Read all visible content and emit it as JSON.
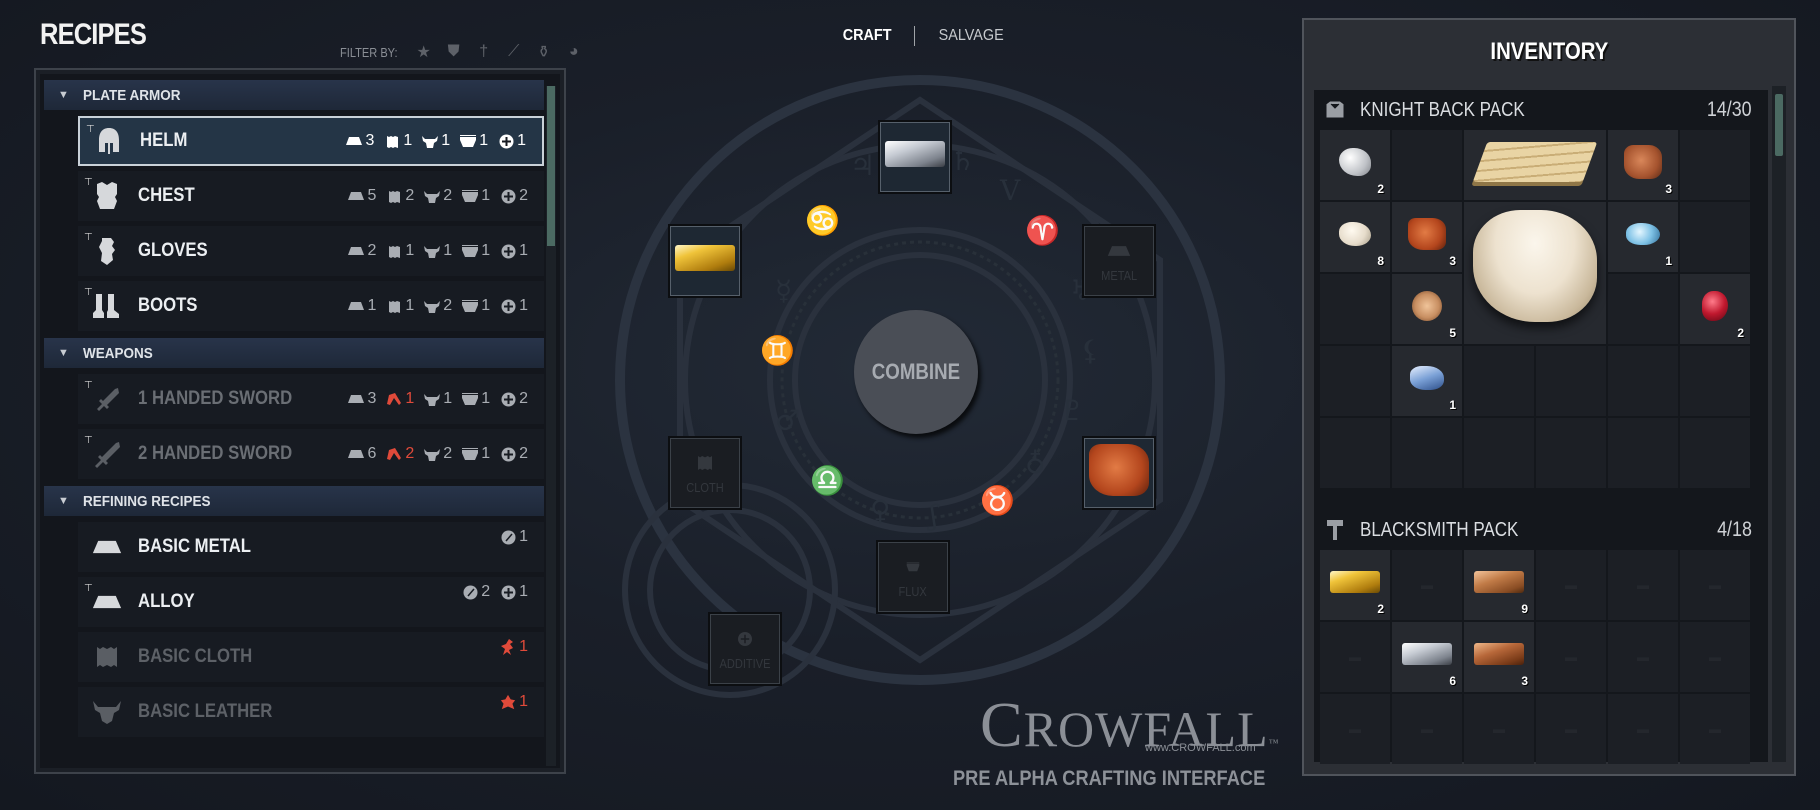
{
  "recipes": {
    "title": "RECIPES",
    "filter_label": "FILTER BY:",
    "filters": [
      {
        "name": "star-filter-icon",
        "glyph": "★"
      },
      {
        "name": "chest-armor-filter-icon",
        "glyph": "⛊"
      },
      {
        "name": "sword-filter-icon",
        "glyph": "†"
      },
      {
        "name": "tool-filter-icon",
        "glyph": "⟋"
      },
      {
        "name": "potion-filter-icon",
        "glyph": "⚱"
      },
      {
        "name": "resource-filter-icon",
        "glyph": "◕"
      }
    ],
    "categories": [
      {
        "label": "PLATE ARMOR",
        "items": [
          {
            "name": "HELM",
            "icon": "helm-icon",
            "hammer": true,
            "selected": true,
            "reqs": [
              {
                "type": "metal",
                "qty": "3"
              },
              {
                "type": "cloth",
                "qty": "1"
              },
              {
                "type": "leather",
                "qty": "1"
              },
              {
                "type": "flux",
                "qty": "1"
              },
              {
                "type": "additive",
                "qty": "1"
              }
            ]
          },
          {
            "name": "CHEST",
            "icon": "chest-icon",
            "hammer": true,
            "reqs": [
              {
                "type": "metal",
                "qty": "5"
              },
              {
                "type": "cloth",
                "qty": "2"
              },
              {
                "type": "leather",
                "qty": "2"
              },
              {
                "type": "flux",
                "qty": "1"
              },
              {
                "type": "additive",
                "qty": "2"
              }
            ]
          },
          {
            "name": "GLOVES",
            "icon": "gloves-icon",
            "hammer": true,
            "reqs": [
              {
                "type": "metal",
                "qty": "2"
              },
              {
                "type": "cloth",
                "qty": "1"
              },
              {
                "type": "leather",
                "qty": "1"
              },
              {
                "type": "flux",
                "qty": "1"
              },
              {
                "type": "additive",
                "qty": "1"
              }
            ]
          },
          {
            "name": "BOOTS",
            "icon": "boots-icon",
            "hammer": true,
            "reqs": [
              {
                "type": "metal",
                "qty": "1"
              },
              {
                "type": "cloth",
                "qty": "1"
              },
              {
                "type": "leather",
                "qty": "2"
              },
              {
                "type": "flux",
                "qty": "1"
              },
              {
                "type": "additive",
                "qty": "1"
              }
            ]
          }
        ]
      },
      {
        "label": "WEAPONS",
        "items": [
          {
            "name": "1 HANDED SWORD",
            "icon": "sword-icon",
            "hammer": true,
            "disabled": true,
            "reqs": [
              {
                "type": "metal",
                "qty": "3"
              },
              {
                "type": "hilt",
                "qty": "1",
                "missing": true
              },
              {
                "type": "leather",
                "qty": "1"
              },
              {
                "type": "flux",
                "qty": "1"
              },
              {
                "type": "additive",
                "qty": "2"
              }
            ]
          },
          {
            "name": "2 HANDED SWORD",
            "icon": "greatsword-icon",
            "hammer": true,
            "disabled": true,
            "reqs": [
              {
                "type": "metal",
                "qty": "6"
              },
              {
                "type": "hilt",
                "qty": "2",
                "missing": true
              },
              {
                "type": "leather",
                "qty": "2"
              },
              {
                "type": "flux",
                "qty": "1"
              },
              {
                "type": "additive",
                "qty": "2"
              }
            ]
          }
        ]
      },
      {
        "label": "REFINING RECIPES",
        "items": [
          {
            "name": "BASIC METAL",
            "icon": "metal-ingot-icon",
            "hammer": false,
            "reqs_up": true,
            "reqs": [
              {
                "type": "ore",
                "qty": "1"
              }
            ]
          },
          {
            "name": "ALLOY",
            "icon": "metal-ingot-icon",
            "hammer": true,
            "reqs_up": true,
            "reqs": [
              {
                "type": "ore",
                "qty": "2"
              },
              {
                "type": "additive",
                "qty": "1"
              }
            ]
          },
          {
            "name": "BASIC CLOTH",
            "icon": "cloth-icon",
            "hammer": false,
            "dim": true,
            "reqs_up": true,
            "reqs": [
              {
                "type": "fiber",
                "qty": "1",
                "missing": true
              }
            ]
          },
          {
            "name": "BASIC LEATHER",
            "icon": "leather-icon",
            "hammer": false,
            "dim": true,
            "reqs_up": true,
            "reqs": [
              {
                "type": "hide",
                "qty": "1",
                "missing": true
              }
            ]
          }
        ]
      }
    ]
  },
  "mode_tabs": {
    "craft": "CRAFT",
    "salvage": "SALVAGE",
    "active": "craft"
  },
  "crafting": {
    "combine_label": "COMBINE",
    "slots": [
      {
        "id": "top",
        "filled": true,
        "item": "silver-ingot"
      },
      {
        "id": "upper-left",
        "filled": true,
        "item": "gold-ingot"
      },
      {
        "id": "upper-right",
        "filled": false,
        "label": "METAL",
        "icon": "metal-ingot-icon"
      },
      {
        "id": "lower-left",
        "filled": false,
        "label": "CLOTH",
        "icon": "cloth-icon"
      },
      {
        "id": "lower-right",
        "filled": true,
        "item": "leather-hide"
      },
      {
        "id": "bottom",
        "filled": false,
        "label": "FLUX",
        "icon": "flux-bowl-icon"
      },
      {
        "id": "additive",
        "filled": false,
        "label": "ADDITIVE",
        "icon": "additive-plus-icon"
      }
    ]
  },
  "branding": {
    "logo_text": "CROWFALL",
    "trademark": "™",
    "url": "www.CROWFALL.com",
    "subtitle": "PRE ALPHA CRAFTING INTERFACE"
  },
  "inventory": {
    "title": "INVENTORY",
    "packs": [
      {
        "name": "KNIGHT BACK PACK",
        "icon": "backpack-icon",
        "count": "14/30",
        "items": [
          {
            "item": "white-rock",
            "qty": "2",
            "col": 1,
            "row": 1
          },
          {
            "item": "wood-planks",
            "qty": "",
            "col": 3,
            "row": 1,
            "span_cols": 2
          },
          {
            "item": "light-hide",
            "qty": "3",
            "col": 5,
            "row": 1
          },
          {
            "item": "cream-rock",
            "qty": "8",
            "col": 1,
            "row": 2
          },
          {
            "item": "red-hide",
            "qty": "3",
            "col": 2,
            "row": 2
          },
          {
            "item": "large-stone",
            "qty": "",
            "col": 3,
            "row": 2,
            "span_cols": 2,
            "span_rows": 2
          },
          {
            "item": "blue-gem",
            "qty": "1",
            "col": 5,
            "row": 2
          },
          {
            "item": "wood-log",
            "qty": "5",
            "col": 2,
            "row": 3
          },
          {
            "item": "ruby",
            "qty": "2",
            "col": 6,
            "row": 3
          },
          {
            "item": "lapis-stone",
            "qty": "1",
            "col": 2,
            "row": 4
          }
        ],
        "rows": 5
      },
      {
        "name": "BLACKSMITH PACK",
        "icon": "hammer-icon",
        "count": "4/18",
        "items": [
          {
            "item": "gold-ingot",
            "qty": "2",
            "col": 1,
            "row": 1
          },
          {
            "item": "bronze-ingot",
            "qty": "9",
            "col": 3,
            "row": 1
          },
          {
            "item": "silver-ingot",
            "qty": "6",
            "col": 2,
            "row": 2
          },
          {
            "item": "copper-ingot",
            "qty": "3",
            "col": 3,
            "row": 2
          }
        ],
        "rows": 3
      }
    ]
  }
}
